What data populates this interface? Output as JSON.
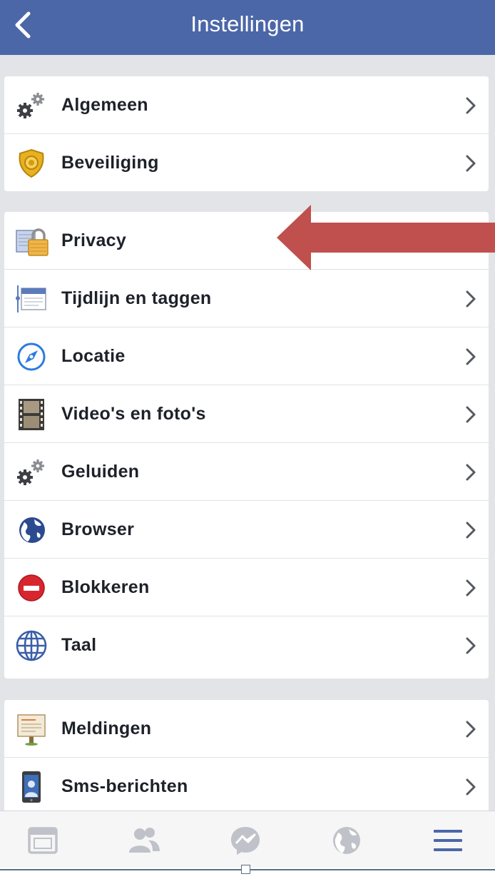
{
  "nav": {
    "title": "Instellingen",
    "back_icon": "chevron-left-icon"
  },
  "groups": [
    {
      "items": [
        {
          "label": "Algemeen",
          "icon": "gears-icon"
        },
        {
          "label": "Beveiliging",
          "icon": "badge-icon"
        }
      ]
    },
    {
      "items": [
        {
          "label": "Privacy",
          "icon": "padlock-icon"
        },
        {
          "label": "Tijdlijn en taggen",
          "icon": "timeline-icon"
        },
        {
          "label": "Locatie",
          "icon": "compass-icon"
        },
        {
          "label": "Video's en foto's",
          "icon": "film-icon"
        },
        {
          "label": "Geluiden",
          "icon": "gears-icon"
        },
        {
          "label": "Browser",
          "icon": "globe-icon"
        },
        {
          "label": "Blokkeren",
          "icon": "block-icon"
        },
        {
          "label": "Taal",
          "icon": "language-globe-icon"
        }
      ]
    },
    {
      "items": [
        {
          "label": "Meldingen",
          "icon": "notice-board-icon"
        },
        {
          "label": "Sms-berichten",
          "icon": "phone-icon"
        }
      ]
    }
  ],
  "annotation": {
    "icon": "red-arrow-icon",
    "color": "#c0504d"
  },
  "tabbar": {
    "tabs": [
      {
        "icon": "news-feed-icon",
        "active": false
      },
      {
        "icon": "friends-icon",
        "active": false
      },
      {
        "icon": "messenger-icon",
        "active": false
      },
      {
        "icon": "notifications-globe-icon",
        "active": false
      },
      {
        "icon": "menu-icon",
        "active": true
      }
    ]
  },
  "colors": {
    "brand": "#4b67a8",
    "background": "#e3e4e8",
    "active_tab": "#4b67a8",
    "inactive_tab": "#bfc2c8"
  }
}
